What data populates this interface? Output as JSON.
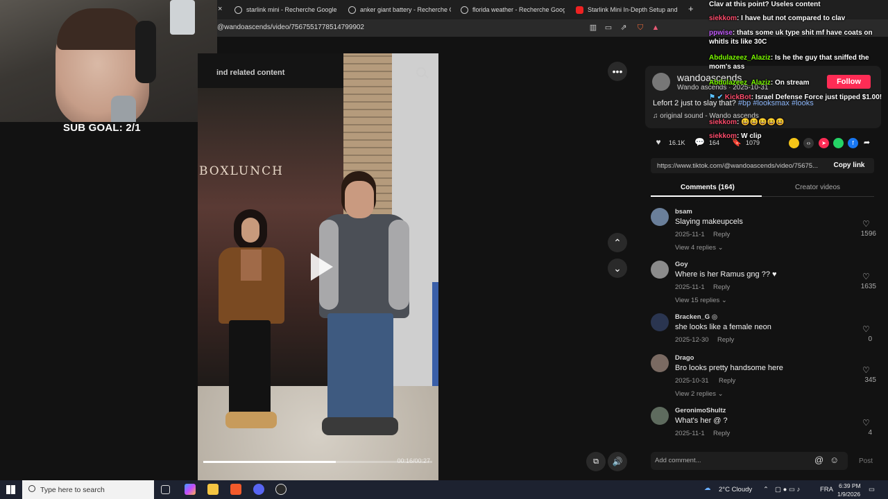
{
  "browser": {
    "tabs": [
      {
        "label": "starlink mini - Recherche Google",
        "close": "×"
      },
      {
        "label": "anker giant battery - Recherche Goog"
      },
      {
        "label": "florida weather - Recherche Google"
      },
      {
        "label": "Starlink Mini In-Depth Setup and Re"
      }
    ],
    "new_tab": "+",
    "url": "@wandoascends/video/7567551778514799902"
  },
  "stream": {
    "sub_goal": "SUB GOAL: 2/1"
  },
  "video": {
    "find_related": "ind related content",
    "store_sign": "BOXLUNCH",
    "progress": 0.58,
    "time": "00:16/00:27"
  },
  "author": {
    "username": "wandoascends",
    "nickname": "Wando ascends",
    "date": "2025-10-31",
    "follow": "Follow",
    "description": "Lefort 2 just to slay that?",
    "tags": "#bp #looksmax #looks",
    "sound": "original sound - Wando ascends"
  },
  "actions": {
    "likes": "16.1K",
    "comments": "164",
    "saves": "1079"
  },
  "share": {
    "link": "https://www.tiktok.com/@wandoascends/video/75675...",
    "copy": "Copy link"
  },
  "panel_tabs": {
    "comments": "Comments (164)",
    "creator": "Creator videos"
  },
  "comments": [
    {
      "user": "bsam",
      "text": "Slaying makeupcels",
      "date": "2025-11-1",
      "reply": "Reply",
      "views": "View 4 replies",
      "likes": "1596"
    },
    {
      "user": "Goy",
      "text": "Where is her Ramus gng ?? ♥",
      "date": "2025-11-1",
      "reply": "Reply",
      "views": "View 15 replies",
      "likes": "1635"
    },
    {
      "user": "Bracken_G",
      "text": "she looks like a female neon",
      "date": "2025-12-30",
      "reply": "Reply",
      "views": "",
      "likes": "0"
    },
    {
      "user": "Drago",
      "text": "Bro looks pretty handsome here",
      "date": "2025-10-31",
      "reply": "Reply",
      "views": "View 2 replies",
      "likes": "345"
    },
    {
      "user": "GeronimoShultz",
      "text": "What's her @ ?",
      "date": "2025-11-1",
      "reply": "Reply",
      "views": "",
      "likes": "4"
    }
  ],
  "composer": {
    "placeholder": "Add comment...",
    "at": "@",
    "post": "Post"
  },
  "chat": [
    {
      "user": "",
      "msg": "Clav at this point? Useles content",
      "color": "#ffffff"
    },
    {
      "user": "siekkom",
      "msg": ": I have but not compared to clav",
      "color": "#ff4d6d"
    },
    {
      "user": "ppwise",
      "msg": ": thats some uk type shit mf have coats on whitls its like 30C",
      "color": "#c45cff"
    },
    {
      "user": "Abdulazeez_Alaziz",
      "msg": ": Is he the guy that sniffed the mom's ass",
      "color": "#7cfc00"
    },
    {
      "user": "Abdulazeez_Alaziz",
      "msg": ": On stream",
      "color": "#7cfc00"
    },
    {
      "user": "KickBot",
      "msg": ": Israel Defense Force just tipped $1.00!",
      "color": "#ff4d6d"
    },
    {
      "user": "siekkom",
      "msg": ": 😆😆😆😆😆",
      "color": "#ff4d6d"
    },
    {
      "user": "siekkom",
      "msg": ": W clip",
      "color": "#ff4d6d"
    }
  ],
  "taskbar": {
    "search": "Type here to search",
    "weather": "2°C Cloudy",
    "lang": "FRA",
    "time": "6:39 PM",
    "date": "1/9/2026"
  }
}
